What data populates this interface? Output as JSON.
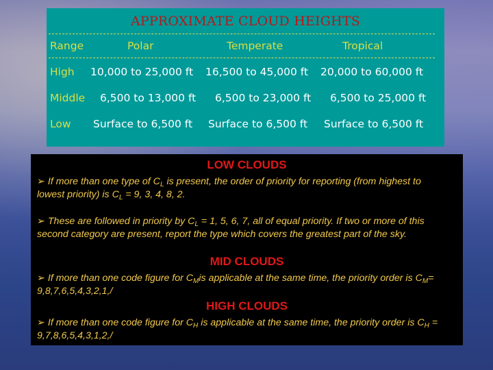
{
  "table": {
    "title": "APPROXIMATE CLOUD HEIGHTS",
    "headers": [
      "Range",
      "Polar",
      "Temperate",
      "Tropical"
    ],
    "rows": [
      {
        "range": "High",
        "polar": "10,000 to 25,000 ft",
        "temperate": "16,500 to 45,000 ft",
        "tropical": "20,000 to 60,000 ft"
      },
      {
        "range": "Middle",
        "polar": "6,500 to 13,000 ft",
        "temperate": "6,500 to 23,000 ft",
        "tropical": "6,500 to 25,000 ft"
      },
      {
        "range": "Low",
        "polar": "Surface to 6,500 ft",
        "temperate": "Surface to 6,500 ft",
        "tropical": "Surface to 6,500 ft"
      }
    ]
  },
  "bullet_glyph": "➢",
  "sections": {
    "low": {
      "title": "LOW CLOUDS",
      "p1": {
        "a": "If more than one type of C",
        "sub1": "L",
        "b": " is present, the order of priority for reporting (from highest to lowest priority) is C",
        "sub2": "L",
        "c": " = 9, 3, 4, 8, 2."
      },
      "p2": {
        "a": "These are followed in priority by C",
        "sub1": "L",
        "b": " = 1, 5, 6, 7, all of equal priority. If two or more of this second category are present, report the type which covers the greatest part of the sky."
      }
    },
    "mid": {
      "title": "MID CLOUDS",
      "p1": {
        "a": "If more than one code figure for C",
        "sub1": "M",
        "b": "is applicable at the same time, the priority order is C",
        "sub2": "M",
        "c": "= 9,8,7,6,5,4,3,2,1,/"
      }
    },
    "high": {
      "title": "HIGH CLOUDS",
      "p1": {
        "a": "If more than one code figure for C",
        "sub1": "H",
        "b": " is applicable at the same time, the priority order is C",
        "sub2": "H",
        "c": " = 9,7,8,6,5,4,3,1,2,/"
      }
    }
  }
}
